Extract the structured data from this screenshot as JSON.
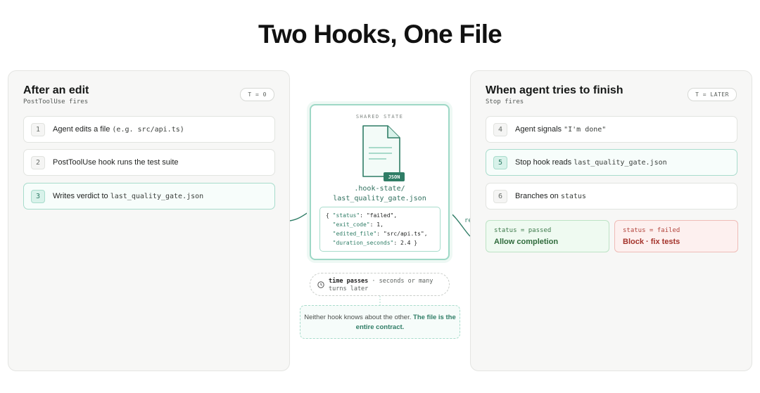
{
  "title": "Two Hooks, One File",
  "left_panel": {
    "title": "After an edit",
    "subtitle": "PostToolUse fires",
    "time_tag": "T = 0",
    "steps": [
      {
        "num": "1",
        "text": "Agent edits a file",
        "code": "(e.g. src/api.ts)"
      },
      {
        "num": "2",
        "text": "PostToolUse hook runs the test suite",
        "code": ""
      },
      {
        "num": "3",
        "text": "Writes verdict to",
        "code": "last_quality_gate.json"
      }
    ]
  },
  "center": {
    "label": "SHARED STATE",
    "file_badge": "JSON",
    "path_line1": ".hook-state/",
    "path_line2": "last_quality_gate.json",
    "json": {
      "status_key": "\"status\"",
      "status_val": "\"failed\"",
      "exit_key": "\"exit_code\"",
      "exit_val": "1",
      "file_key": "\"edited_file\"",
      "file_val": "\"src/api.ts\"",
      "duration_key": "\"duration_seconds\"",
      "duration_val": "2.4"
    },
    "time_bold": "time passes",
    "time_rest": " · seconds or many turns later",
    "note_text": "Neither hook knows about the other. ",
    "note_bold": "The file is the entire contract.",
    "edge_label": "re"
  },
  "right_panel": {
    "title": "When agent tries to finish",
    "subtitle": "Stop fires",
    "time_tag": "T = LATER",
    "steps": [
      {
        "num": "4",
        "text": "Agent signals",
        "code": "\"I'm done\""
      },
      {
        "num": "5",
        "text": "Stop hook reads",
        "code": "last_quality_gate.json"
      },
      {
        "num": "6",
        "text": "Branches on",
        "code": "status"
      }
    ],
    "outcomes": [
      {
        "condition": "status = passed",
        "action": "Allow completion"
      },
      {
        "condition": "status = failed",
        "action": "Block · fix tests"
      }
    ]
  },
  "colors": {
    "accent": "#2f7d66",
    "accent_light": "#a8dccc",
    "pass": "#2f6b3c",
    "fail": "#a4322a"
  }
}
